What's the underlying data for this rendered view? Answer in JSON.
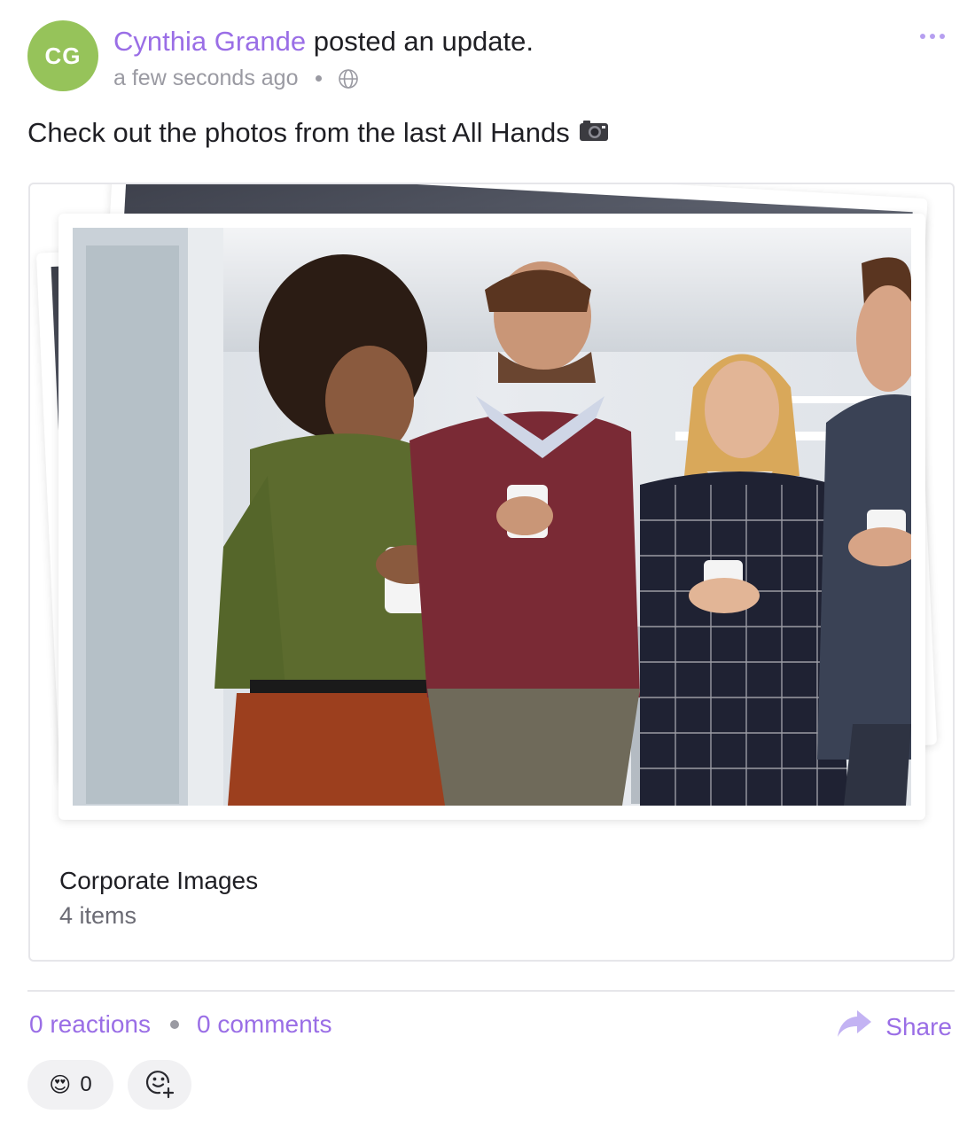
{
  "post": {
    "avatar_initials": "CG",
    "avatar_color": "#96c35a",
    "author": "Cynthia Grande",
    "action": " posted an update.",
    "timestamp": "a few seconds ago",
    "visibility_icon": "globe-icon",
    "more_icon": "more-horizontal-icon",
    "text": "Check out the photos from the last All Hands",
    "text_icon": "camera-icon"
  },
  "album": {
    "title": "Corporate Images",
    "count": "4 items"
  },
  "footer": {
    "reactions": "0 reactions",
    "comments": "0 comments",
    "share_label": "Share",
    "share_icon": "share-arrow-icon",
    "reaction_emoji": "😍",
    "reaction_count": "0",
    "add_reaction_icon": "add-emoji-icon"
  },
  "colors": {
    "accent": "#9a6ee6",
    "muted": "#9a9aa2",
    "border": "#e6e6ea"
  }
}
